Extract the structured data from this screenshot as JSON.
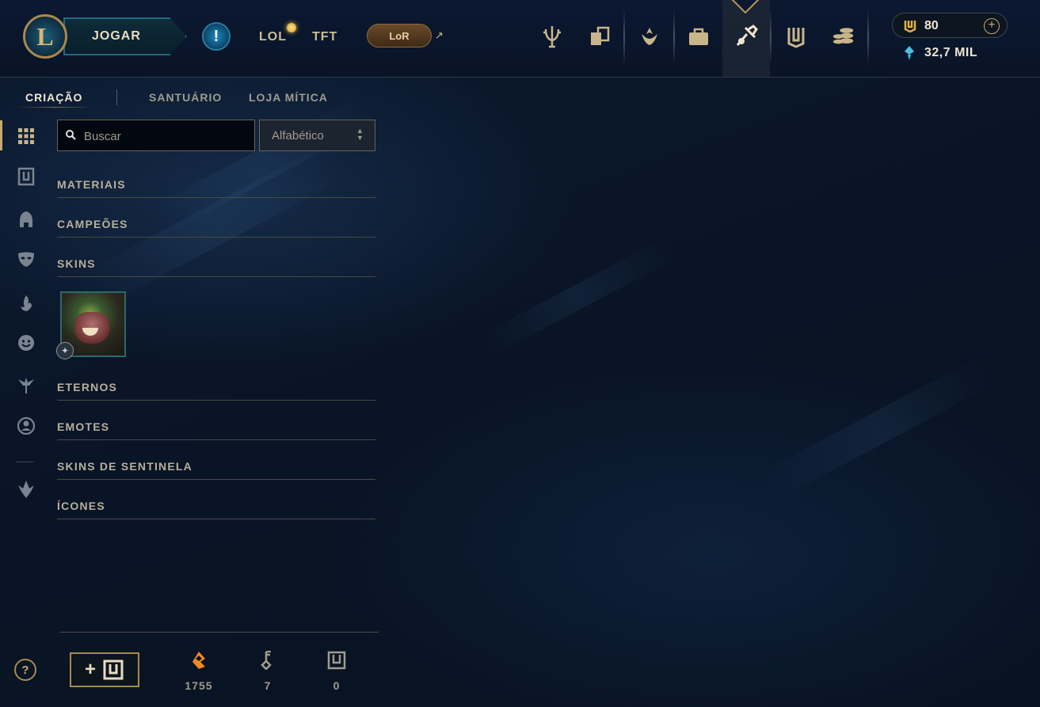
{
  "topbar": {
    "play_label": "JOGAR",
    "modes": [
      "LOL",
      "TFT"
    ],
    "lor_label": "LoR",
    "ext_arrow": "↗",
    "nav_icons": [
      "trophy-icon",
      "cards-icon",
      "ranked-icon",
      "collection-icon",
      "loot-icon",
      "chest-icon",
      "store-icon"
    ],
    "active_nav": "loot-icon",
    "currency": {
      "rp": "80",
      "be": "32,7 MIL"
    }
  },
  "subnav": {
    "tabs": [
      "CRIAÇÃO",
      "SANTUÁRIO",
      "LOJA MÍTICA"
    ],
    "active": 0
  },
  "search": {
    "placeholder": "Buscar"
  },
  "sort": {
    "selected": "Alfabético"
  },
  "categories": [
    "MATERIAIS",
    "CAMPEÕES",
    "SKINS",
    "ETERNOS",
    "EMOTES",
    "SKINS DE SENTINELA",
    "ÍCONES"
  ],
  "skins_items": [
    {
      "name": "skin-tile"
    }
  ],
  "bottom": {
    "resources": [
      {
        "icon": "orange-essence-icon",
        "value": "1755"
      },
      {
        "icon": "key-icon",
        "value": "7"
      },
      {
        "icon": "chest-icon",
        "value": "0"
      }
    ]
  },
  "help": {
    "label": "?"
  },
  "colors": {
    "gold": "#c8aa6e",
    "accent_teal": "#1f6a84",
    "bg": "#0a1428"
  }
}
